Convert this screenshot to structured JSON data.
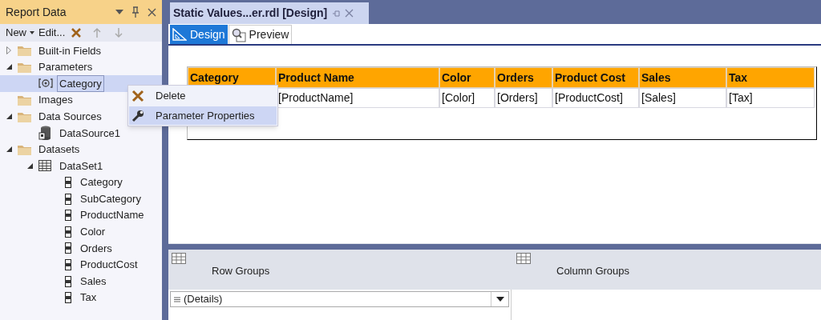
{
  "report_data": {
    "title": "Report Data",
    "toolbar": {
      "new": "New",
      "edit": "Edit..."
    },
    "tree": [
      {
        "label": "Built-in Fields",
        "kind": "folder",
        "expanded": false
      },
      {
        "label": "Parameters",
        "kind": "folder",
        "expanded": true,
        "children": [
          {
            "label": "Category",
            "kind": "parameter",
            "selected": true
          }
        ]
      },
      {
        "label": "Images",
        "kind": "folder"
      },
      {
        "label": "Data Sources",
        "kind": "folder",
        "expanded": true,
        "children": [
          {
            "label": "DataSource1",
            "kind": "datasource",
            "selected": false
          }
        ]
      },
      {
        "label": "Datasets",
        "kind": "folder",
        "expanded": true,
        "children": [
          {
            "label": "DataSet1",
            "kind": "dataset",
            "expanded": true,
            "selected": false,
            "children": [
              {
                "label": "Category",
                "kind": "field",
                "selected": false
              },
              {
                "label": "SubCategory",
                "kind": "field",
                "selected": false
              },
              {
                "label": "ProductName",
                "kind": "field",
                "selected": false
              },
              {
                "label": "Color",
                "kind": "field",
                "selected": false
              },
              {
                "label": "Orders",
                "kind": "field",
                "selected": false
              },
              {
                "label": "ProductCost",
                "kind": "field",
                "selected": false
              },
              {
                "label": "Sales",
                "kind": "field",
                "selected": false
              },
              {
                "label": "Tax",
                "kind": "field",
                "selected": false
              }
            ]
          }
        ]
      }
    ]
  },
  "document_tab": {
    "title": "Static Values...er.rdl [Design]"
  },
  "view_tabs": [
    {
      "label": "Design",
      "selected": true
    },
    {
      "label": "Preview",
      "selected": false
    }
  ],
  "table": {
    "columns": [
      "Category",
      "Product Name",
      "Color",
      "Orders",
      "Product Cost",
      "Sales",
      "Tax"
    ],
    "detail_row": [
      "[ProductName]",
      "[Color]",
      "[Orders]",
      "[ProductCost]",
      "[Sales]",
      "[Tax]"
    ]
  },
  "context_menu": [
    {
      "label": "Delete",
      "kind": "delete",
      "selected": false
    },
    {
      "label": "Parameter Properties",
      "kind": "properties",
      "selected": true
    }
  ],
  "grouping": {
    "row_groups": "Row Groups",
    "column_groups": "Column Groups",
    "row_group_items": [
      "(Details)"
    ]
  }
}
